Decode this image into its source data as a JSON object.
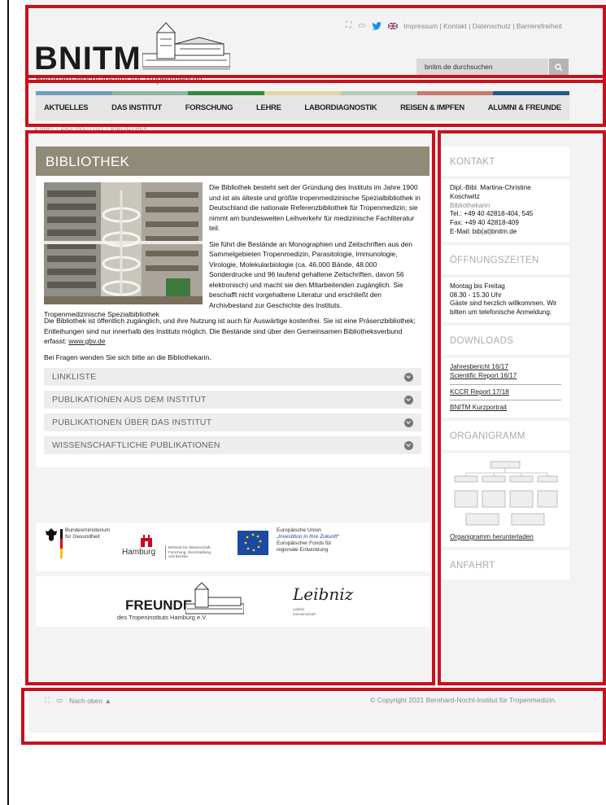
{
  "header": {
    "logo": "BNITM",
    "logo_subtitle": "Bernhard-Nocht-Institut für Tropenmedizin",
    "top_links": "Impressum | Kontakt | Datenschutz | Barrierefreiheit",
    "search_placeholder": "bnitm.de durchsuchen"
  },
  "nav": {
    "items": [
      "AKTUELLES",
      "DAS INSTITUT",
      "FORSCHUNG",
      "LEHRE",
      "LABORDIAGNOSTIK",
      "REISEN & IMPFEN",
      "ALUMNI & FREUNDE"
    ],
    "stripe_colors": [
      "#6f9fbf",
      "#8bb5a3",
      "#2e8b3e",
      "#e0d6a6",
      "#b9c8b8",
      "#c87a70",
      "#1f5a8c"
    ]
  },
  "breadcrumb": "START › DAS INSTITUT › BIBLIOTHEK",
  "main": {
    "title": "BIBLIOTHEK",
    "photo_caption": "Tropenmedizinische Spezialbibliothek",
    "p1": "Die Bibliothek besteht seit der Gründung des Instituts im Jahre 1900 und ist als älteste und größte tropenmedizinische Spezialbibliothek in Deutschland die nationale Referenzbibliothek für Tropenmedizin; sie nimmt am bundesweiten Leihverkehr für medizinische Fachliteratur teil.",
    "p2": "Sie führt die Bestände an Monographien und Zeitschriften aus den Sammelgebieten Tropenmedizin, Parasitologie, Immunologie, Virologie, Molekularbiologie (ca. 46.000 Bände, 48.000 Sonderdrucke und 96 laufend gehaltene Zeitschriften, davon 56 elektronisch) und macht sie den Mitarbeitenden zugänglich. Sie beschafft nicht vorgehaltene Literatur und erschließt den Archivbestand zur Geschichte des Instituts.",
    "p3": "Die Bibliothek ist öffentlich zugänglich, und ihre Nutzung ist auch für Auswärtige kostenfrei. Sie ist eine Präsenzbibliothek; Entleihungen sind nur innerhalb des Instituts möglich. Die Bestände sind über den Gemeinsamen Bibliotheksverbund erfasst:",
    "p3_link": "www.gbv.de",
    "p4": "Bei Fragen wenden Sie sich bitte an die Bibliothekarin.",
    "accordion": [
      "LINKLISTE",
      "PUBLIKATIONEN AUS DEM INSTITUT",
      "PUBLIKATIONEN ÜBER DAS INSTITUT",
      "WISSENSCHAFTLICHE PUBLIKATIONEN"
    ]
  },
  "partners": {
    "bmg_line1": "Bundesministerium",
    "bmg_line2": "für Gesundheit",
    "hamburg": "Hamburg",
    "hamburg_sub1": "Behörde für Wissenschaft,",
    "hamburg_sub2": "Forschung, Gleichstellung",
    "hamburg_sub3": "und Bezirke",
    "eu_line1": "Europäische Union",
    "eu_line2": "„Investition in Ihre Zukunft“",
    "eu_line3": "Europäischer Fonds für",
    "eu_line4": "regionale Entwicklung",
    "freunde": "FREUNDE",
    "freunde_sub": "des Tropeninstituts Hamburg e.V.",
    "leibniz": "Leibniz",
    "leibniz_sub1": "Leibniz",
    "leibniz_sub2": "Gemeinschaft"
  },
  "sidebar": {
    "kontakt_head": "KONTAKT",
    "kontakt_name": "Dipl.-Bibl. Martina-Christine Koschwitz",
    "kontakt_role": "Bibliothekarin",
    "kontakt_tel": "Tel.: +49 40 42818-404, 545",
    "kontakt_fax": "Fax: +49 40 42818-409",
    "kontakt_email": "E-Mail: bib(at)bnitm.de",
    "oeffnung_head": "ÖFFNUNGSZEITEN",
    "oeffnung_days": "Montag bis Freitag",
    "oeffnung_hours": "08.30 - 15.30 Uhr",
    "oeffnung_note": "Gäste sind herzlich willkommen. Wir bitten um telefonische Anmeldung.",
    "downloads_head": "DOWNLOADS",
    "downloads": [
      "Jahresbericht 16/17",
      "Scientific Report 16/17",
      "KCCR Report 17/18",
      "BNITM Kurzportrait"
    ],
    "organigramm_head": "ORGANIGRAMM",
    "organigramm_link": "Organigramm herunterladen",
    "anfahrt_head": "ANFAHRT"
  },
  "footer": {
    "nach_oben": "Nach oben",
    "copyright": "© Copyright 2021 Bernhard-Nocht-Institut für Tropenmedizin."
  }
}
